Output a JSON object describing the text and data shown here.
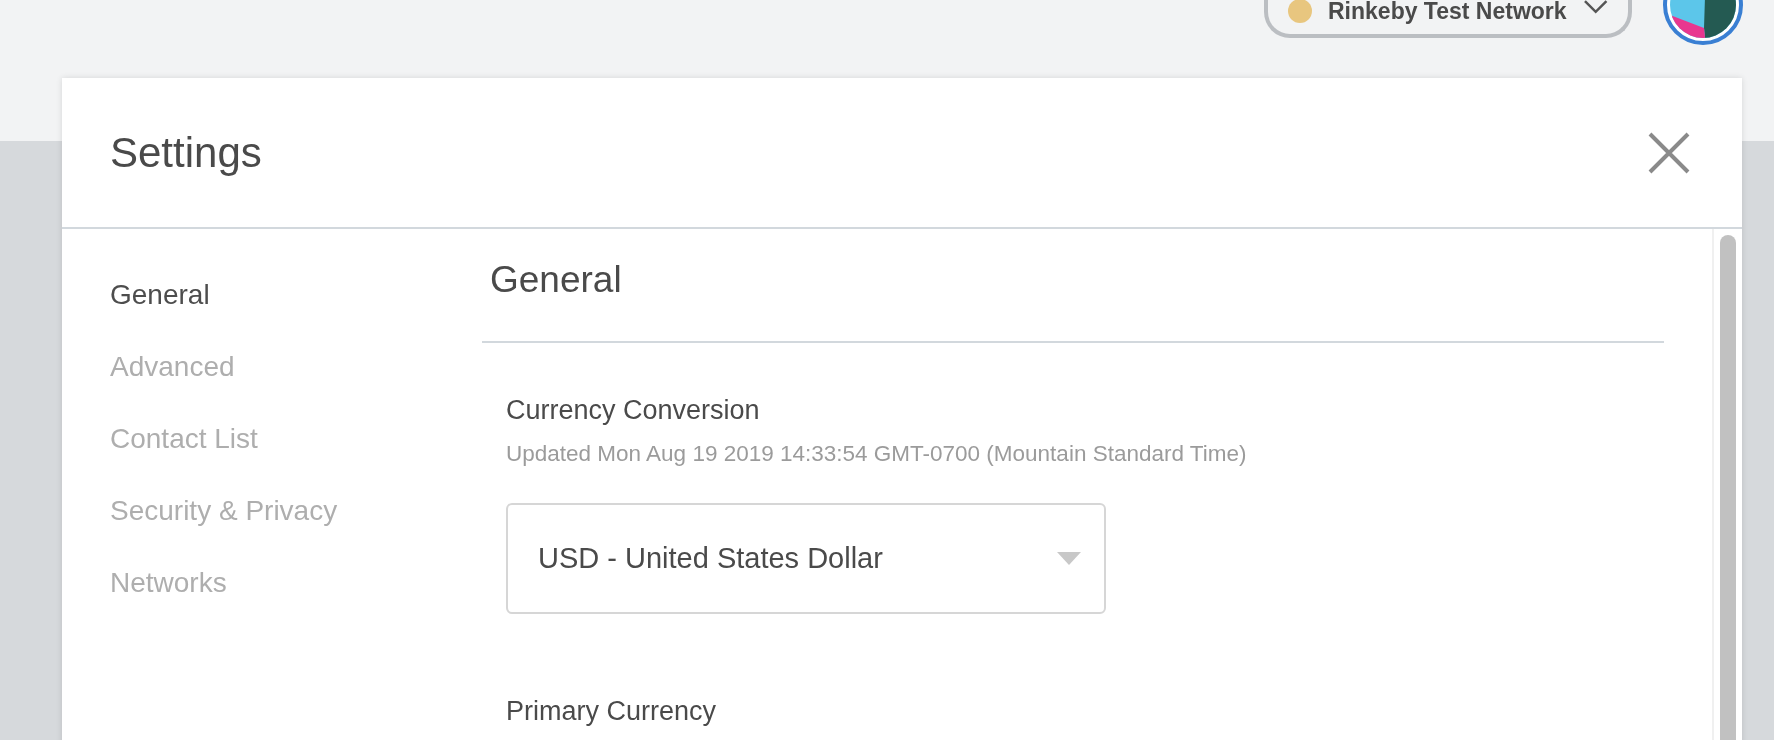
{
  "network": {
    "label": "Rinkeby Test Network",
    "color": "#e8c67f"
  },
  "modal": {
    "title": "Settings"
  },
  "sidebar": {
    "items": [
      {
        "label": "General",
        "selected": true
      },
      {
        "label": "Advanced",
        "selected": false
      },
      {
        "label": "Contact List",
        "selected": false
      },
      {
        "label": "Security & Privacy",
        "selected": false
      },
      {
        "label": "Networks",
        "selected": false
      }
    ]
  },
  "content": {
    "heading": "General",
    "sections": [
      {
        "kind": "select",
        "title": "Currency Conversion",
        "description": "Updated Mon Aug 19 2019 14:33:54 GMT-0700 (Mountain Standard Time)",
        "value": "USD - United States Dollar"
      },
      {
        "kind": "title",
        "title": "Primary Currency"
      }
    ]
  }
}
